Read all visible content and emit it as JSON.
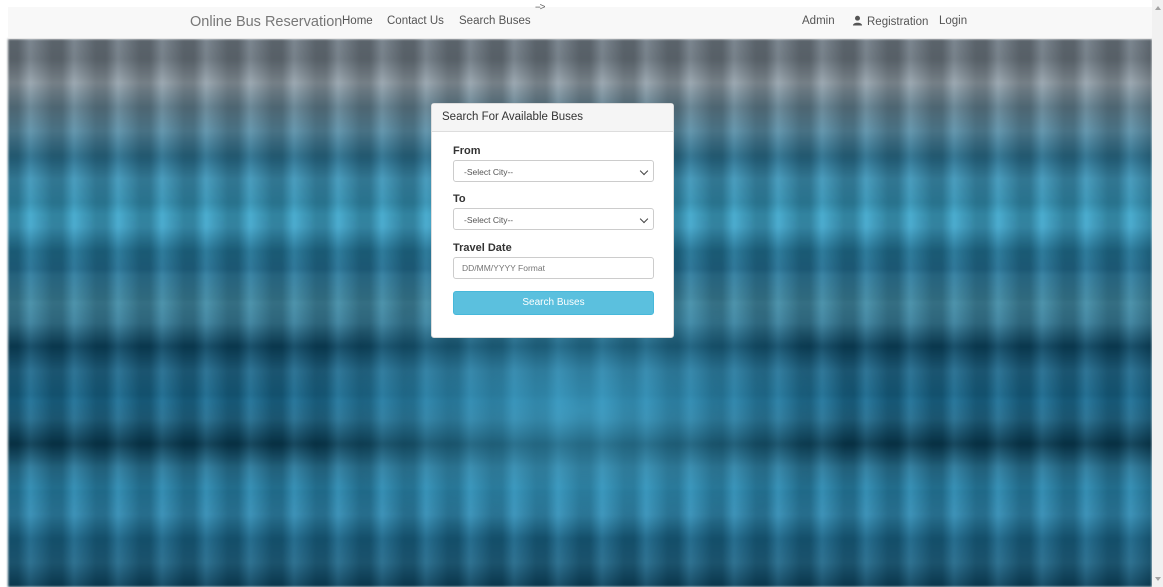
{
  "navbar": {
    "brand": "Online Bus Reservation",
    "links": [
      "Home",
      "Contact Us",
      "Search Buses"
    ],
    "stray_text": "-->",
    "right_links": [
      "Admin",
      "Registration",
      "Login"
    ],
    "registration_icon": "user-icon"
  },
  "search_panel": {
    "title": "Search For Available Buses",
    "from_label": "From",
    "from_value": "-Select City--",
    "to_label": "To",
    "to_value": "-Select City--",
    "date_label": "Travel Date",
    "date_placeholder": "DD/MM/YYYY Format",
    "button_label": "Search Buses"
  },
  "colors": {
    "button": "#5bc0de",
    "navbar_bg": "#f8f8f8"
  }
}
